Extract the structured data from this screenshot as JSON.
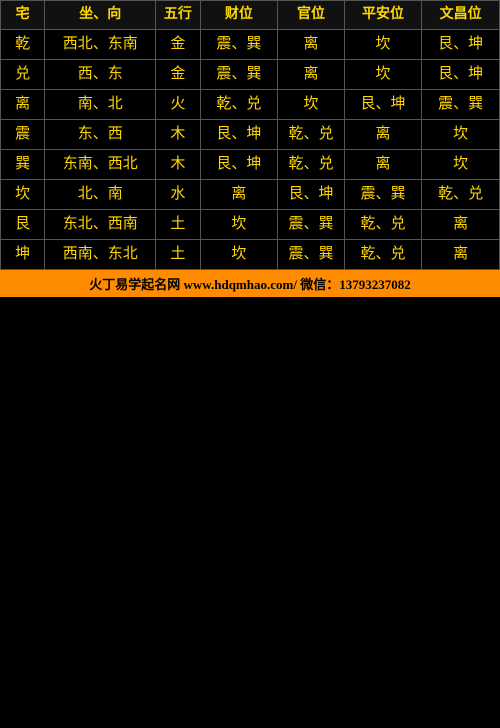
{
  "header": {
    "cols": [
      "宅",
      "坐、向",
      "五行",
      "财位",
      "官位",
      "平安位",
      "文昌位"
    ]
  },
  "rows": [
    {
      "zhai": "乾",
      "zuo": "西北、东南",
      "wu": "金",
      "cai": "震、巽",
      "guan": "离",
      "ping": "坎",
      "wen": "艮、坤"
    },
    {
      "zhai": "兑",
      "zuo": "西、东",
      "wu": "金",
      "cai": "震、巽",
      "guan": "离",
      "ping": "坎",
      "wen": "艮、坤"
    },
    {
      "zhai": "离",
      "zuo": "南、北",
      "wu": "火",
      "cai": "乾、兑",
      "guan": "坎",
      "ping": "艮、坤",
      "wen": "震、巽"
    },
    {
      "zhai": "震",
      "zuo": "东、西",
      "wu": "木",
      "cai": "艮、坤",
      "guan": "乾、兑",
      "ping": "离",
      "wen": "坎"
    },
    {
      "zhai": "巽",
      "zuo": "东南、西北",
      "wu": "木",
      "cai": "艮、坤",
      "guan": "乾、兑",
      "ping": "离",
      "wen": "坎"
    },
    {
      "zhai": "坎",
      "zuo": "北、南",
      "wu": "水",
      "cai": "离",
      "guan": "艮、坤",
      "ping": "震、巽",
      "wen": "乾、兑"
    },
    {
      "zhai": "艮",
      "zuo": "东北、西南",
      "wu": "土",
      "cai": "坎",
      "guan": "震、巽",
      "ping": "乾、兑",
      "wen": "离"
    },
    {
      "zhai": "坤",
      "zuo": "西南、东北",
      "wu": "土",
      "cai": "坎",
      "guan": "震、巽",
      "ping": "乾、兑",
      "wen": "离"
    }
  ],
  "footer": "火丁易学起名网 www.hdqmhao.com/ 微信：13793237082"
}
